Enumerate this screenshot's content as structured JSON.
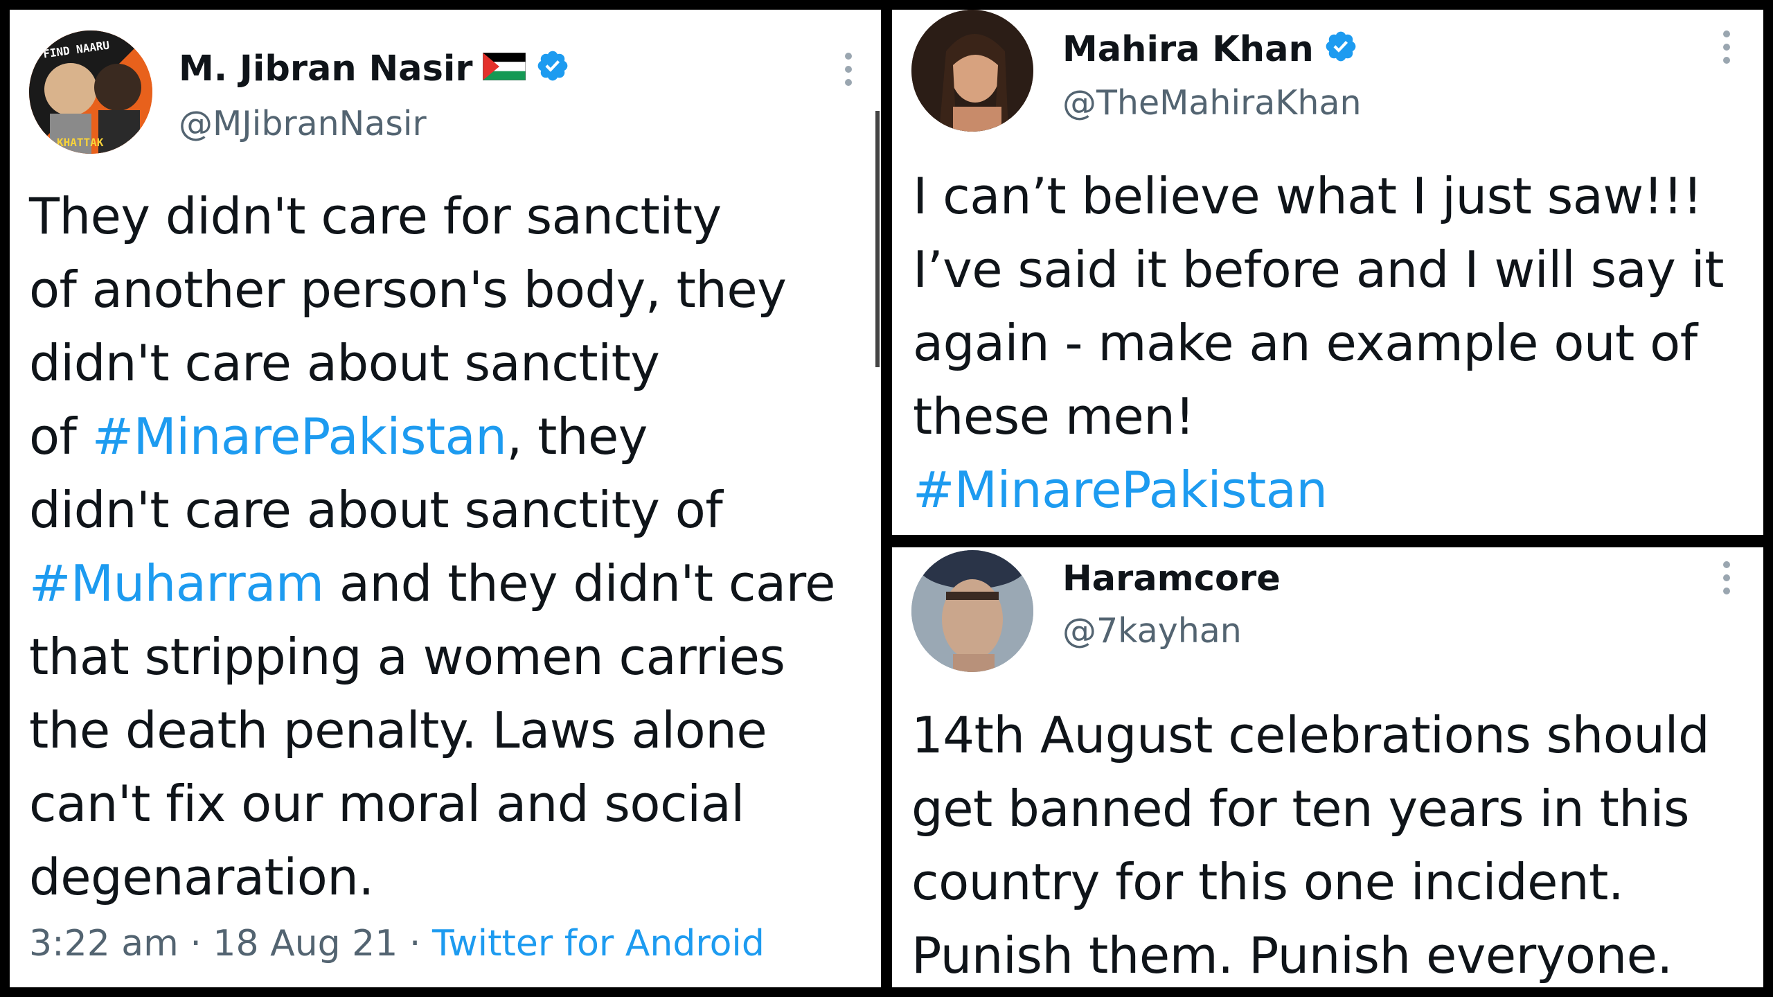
{
  "tweets": [
    {
      "name": "M. Jibran Nasir",
      "handle": "@MJibranNasir",
      "avatar_text_top": "FIND NAARU",
      "avatar_text_bottom": "KHATTAK",
      "body_lines": [
        [
          {
            "t": "They didn't care for sanctity"
          }
        ],
        [
          {
            "t": "of another person's body, they"
          }
        ],
        [
          {
            "t": "didn't care about sanctity"
          }
        ],
        [
          {
            "t": "of "
          },
          {
            "t": "#MinarePakistan",
            "tag": true
          },
          {
            "t": ", they"
          }
        ],
        [
          {
            "t": "didn't care about sanctity of"
          }
        ],
        [
          {
            "t": "#Muharram",
            "tag": true
          },
          {
            "t": " and they didn't care"
          }
        ],
        [
          {
            "t": "that stripping a women carries"
          }
        ],
        [
          {
            "t": "the death penalty. Laws alone"
          }
        ],
        [
          {
            "t": "can't fix our moral and social"
          }
        ],
        [
          {
            "t": "degenaration."
          }
        ]
      ],
      "time": "3:22 am",
      "date": "18 Aug 21",
      "source": "Twitter for Android",
      "separator": " · "
    },
    {
      "name": "Mahira Khan",
      "handle": "@TheMahiraKhan",
      "body_lines": [
        [
          {
            "t": "I can’t believe what I just saw!!!"
          }
        ],
        [
          {
            "t": "I’ve said it before and I will say it"
          }
        ],
        [
          {
            "t": "again - make an example out of"
          }
        ],
        [
          {
            "t": "these men!"
          }
        ],
        [
          {
            "t": " "
          },
          {
            "t": "#MinarePakistan",
            "tag": true
          }
        ]
      ]
    },
    {
      "name": "Haramcore",
      "handle": "@7kayhan",
      "body_lines": [
        [
          {
            "t": "14th August celebrations should"
          }
        ],
        [
          {
            "t": "get banned for ten years in this"
          }
        ],
        [
          {
            "t": "country for this one incident."
          }
        ],
        [
          {
            "t": "Punish them. Punish everyone."
          }
        ]
      ]
    }
  ],
  "colors": {
    "link": "#1d9bf0",
    "muted": "#536471",
    "text": "#0f1419",
    "verified": "#1d9bf0"
  },
  "icons": [
    "verified-badge-icon",
    "palestine-flag-icon",
    "more-options-icon"
  ]
}
